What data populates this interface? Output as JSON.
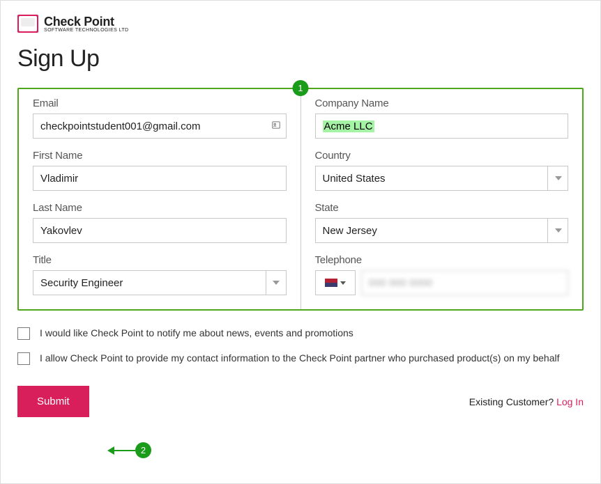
{
  "logo": {
    "main": "Check Point",
    "sub": "SOFTWARE TECHNOLOGIES LTD"
  },
  "page_title": "Sign Up",
  "annotations": {
    "badge1": "1",
    "badge2": "2"
  },
  "left": {
    "email_label": "Email",
    "email_value": "checkpointstudent001@gmail.com",
    "first_name_label": "First Name",
    "first_name_value": "Vladimir",
    "last_name_label": "Last Name",
    "last_name_value": "Yakovlev",
    "title_label": "Title",
    "title_value": "Security Engineer"
  },
  "right": {
    "company_label": "Company Name",
    "company_value": "Acme LLC",
    "country_label": "Country",
    "country_value": "United States",
    "state_label": "State",
    "state_value": "New Jersey",
    "telephone_label": "Telephone",
    "telephone_value": "000 000 0000"
  },
  "checkboxes": {
    "cb1": "I would like Check Point to notify me about news, events and promotions",
    "cb2": "I allow Check Point to provide my contact information to the Check Point partner who purchased product(s) on my behalf"
  },
  "submit_label": "Submit",
  "existing_text": "Existing Customer? ",
  "login_text": "Log In"
}
